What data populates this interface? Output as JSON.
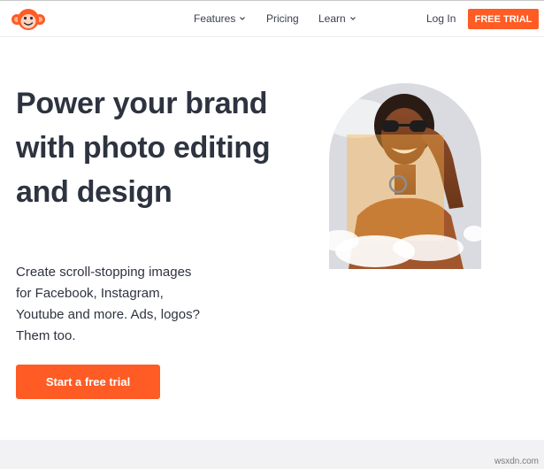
{
  "nav": {
    "items": [
      {
        "label": "Features",
        "has_dropdown": true
      },
      {
        "label": "Pricing",
        "has_dropdown": false
      },
      {
        "label": "Learn",
        "has_dropdown": true
      }
    ],
    "login_label": "Log In",
    "cta_label": "FREE TRIAL"
  },
  "hero": {
    "title": "Power your brand with photo editing and design",
    "subtitle": "Create scroll-stopping images for Facebook, Instagram, Youtube and more. Ads, logos? Them too.",
    "cta_label": "Start a free trial"
  },
  "watermark": "wsxdn.com",
  "colors": {
    "accent": "#ff5b24",
    "text": "#2e3340",
    "band": "#f2f2f4"
  },
  "icons": {
    "logo": "monkey-logo-icon",
    "dropdown": "chevron-down-icon"
  }
}
